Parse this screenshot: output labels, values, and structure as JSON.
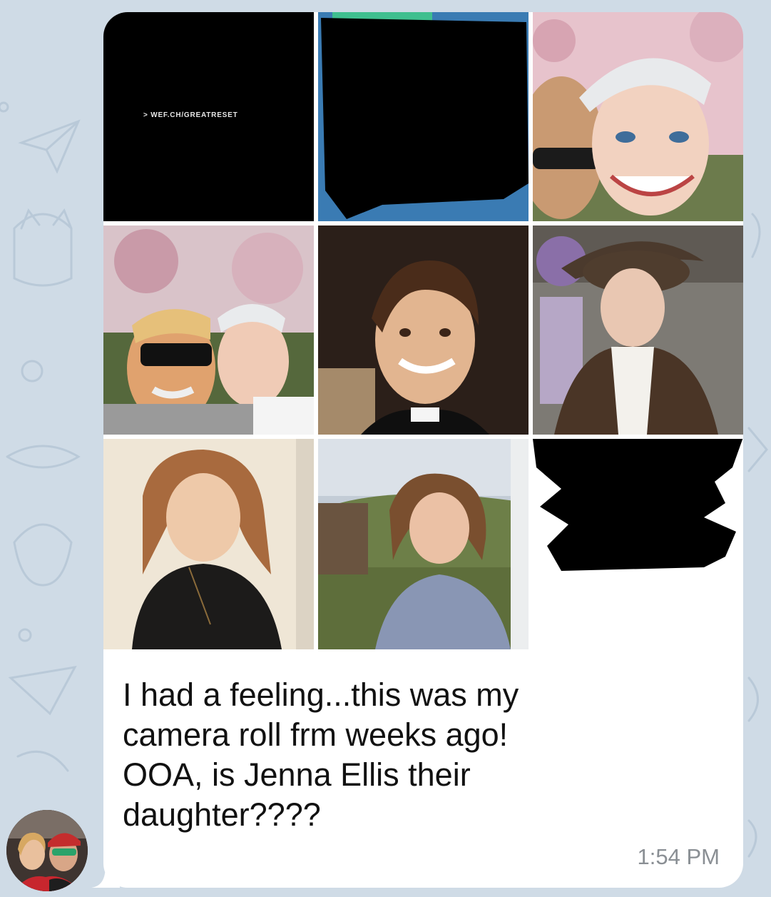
{
  "message": {
    "image_caption_text": "> WEF.CH/GREATRESET",
    "text": "I had a feeling...this was my\ncamera roll frm weeks ago!\nOOA, is Jenna Ellis their\ndaughter????",
    "time": "1:54 PM"
  },
  "photos": [
    {
      "name": "wef-black-card"
    },
    {
      "name": "redacted-photo"
    },
    {
      "name": "woman-white-cap-selfie"
    },
    {
      "name": "couple-selfie-sunglasses"
    },
    {
      "name": "boy-smiling-portrait"
    },
    {
      "name": "woman-brown-hat"
    },
    {
      "name": "girl-black-sweater"
    },
    {
      "name": "girl-outdoors-blue-sweater"
    },
    {
      "name": "redacted-text-screenshot"
    }
  ],
  "icons": [
    "avatar",
    "paper-plane-icon",
    "cat-doodle-icon"
  ],
  "colors": {
    "wallpaper": "#cfdbe6",
    "bubble": "#ffffff",
    "text": "#111111",
    "timestamp": "#8a8f94"
  }
}
